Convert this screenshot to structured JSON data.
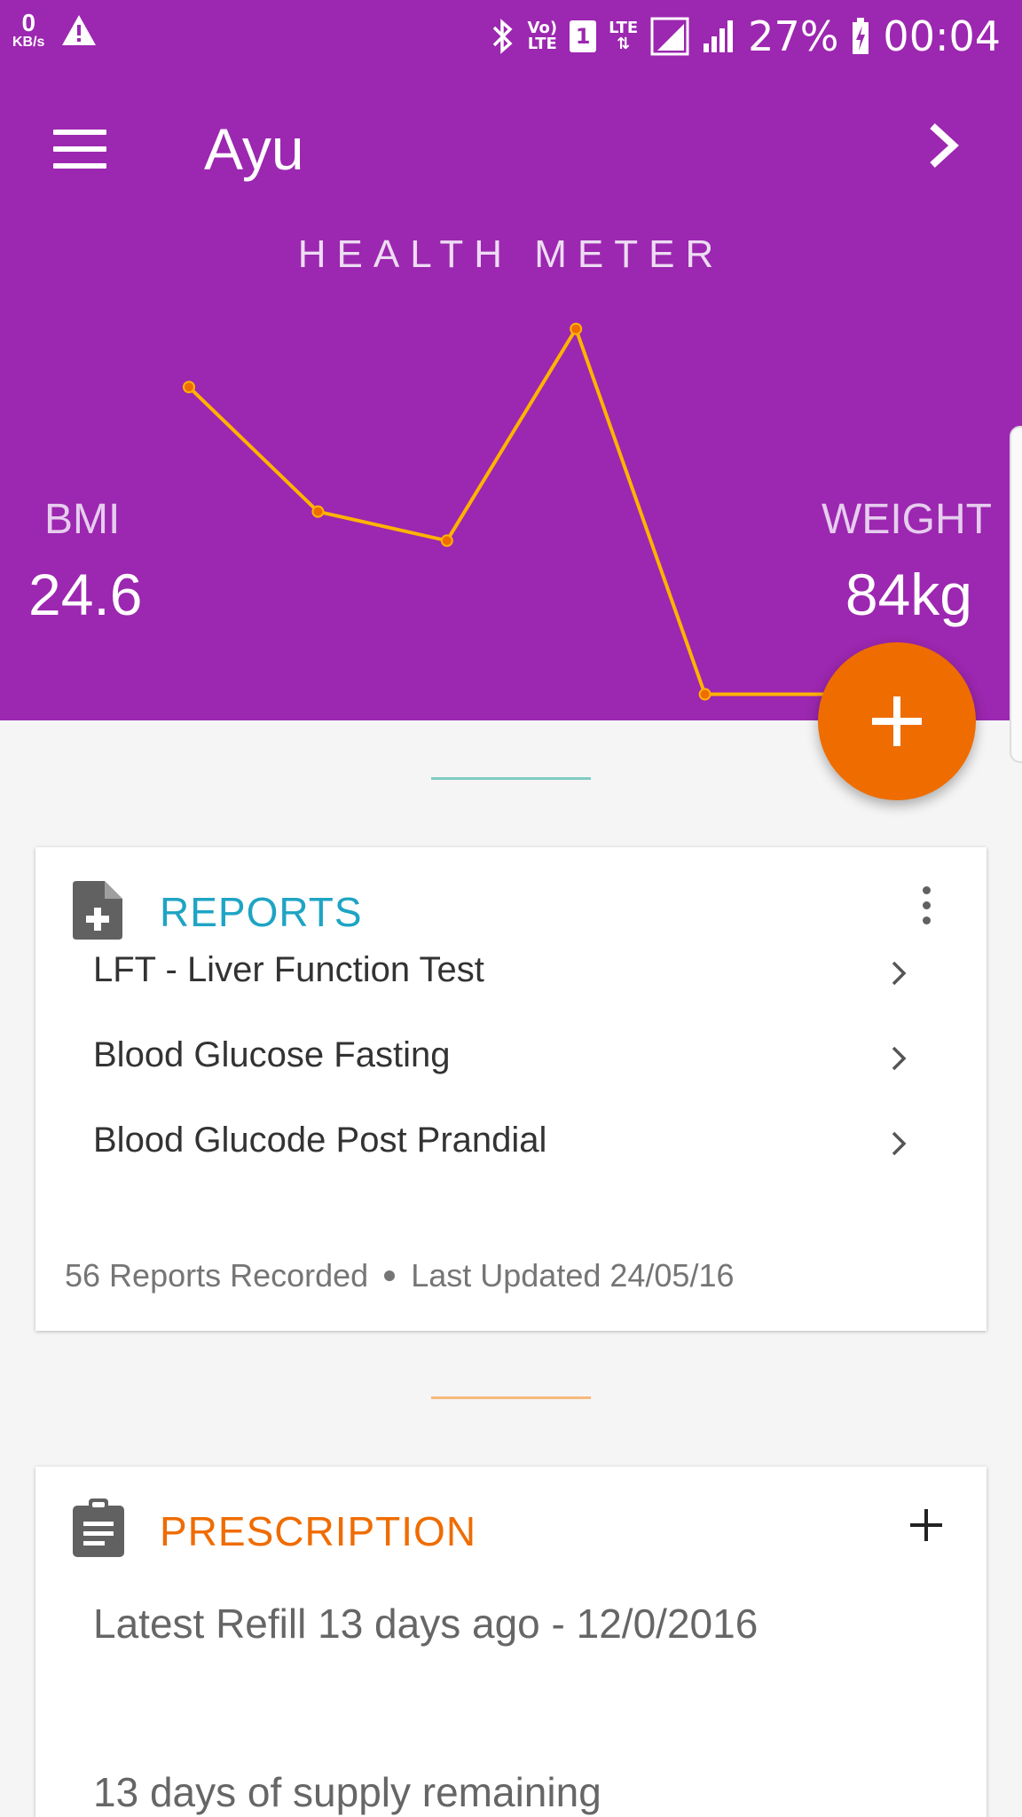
{
  "status_bar": {
    "speed_value": "0",
    "speed_unit": "KB/s",
    "network_top": "Vo)",
    "network_bottom": "LTE",
    "sim": "1",
    "lte": "LTE",
    "battery": "27%",
    "time": "00:04"
  },
  "header": {
    "title": "Ayu",
    "meter_title": "HEALTH METER",
    "bmi_label": "BMI",
    "bmi_value": "24.6",
    "weight_label": "WEIGHT",
    "weight_value": "84kg"
  },
  "chart_data": {
    "type": "line",
    "title": "HEALTH METER",
    "x": [
      1,
      2,
      3,
      4,
      5,
      6
    ],
    "series": [
      {
        "values": [
          0.82,
          0.52,
          0.45,
          0.96,
          0.08,
          0.08
        ]
      }
    ],
    "ylim": [
      0,
      1
    ],
    "grid": false,
    "line_color": "#ffb300",
    "point_color": "#ef6c00"
  },
  "reports": {
    "title": "REPORTS",
    "items": [
      {
        "label": "LFT - Liver Function Test"
      },
      {
        "label": "Blood Glucose Fasting"
      },
      {
        "label": "Blood Glucode Post Prandial"
      }
    ],
    "count_text": "56 Reports Recorded",
    "updated_text": "Last Updated 24/05/16"
  },
  "prescription": {
    "title": "PRESCRIPTION",
    "refill_text": "Latest Refill 13 days ago - 12/0/2016",
    "supply_text": "13 days of supply remaining"
  },
  "colors": {
    "header": "#9c27b0",
    "accent_orange": "#ef6c00",
    "reports_teal": "#1ea4c4"
  }
}
